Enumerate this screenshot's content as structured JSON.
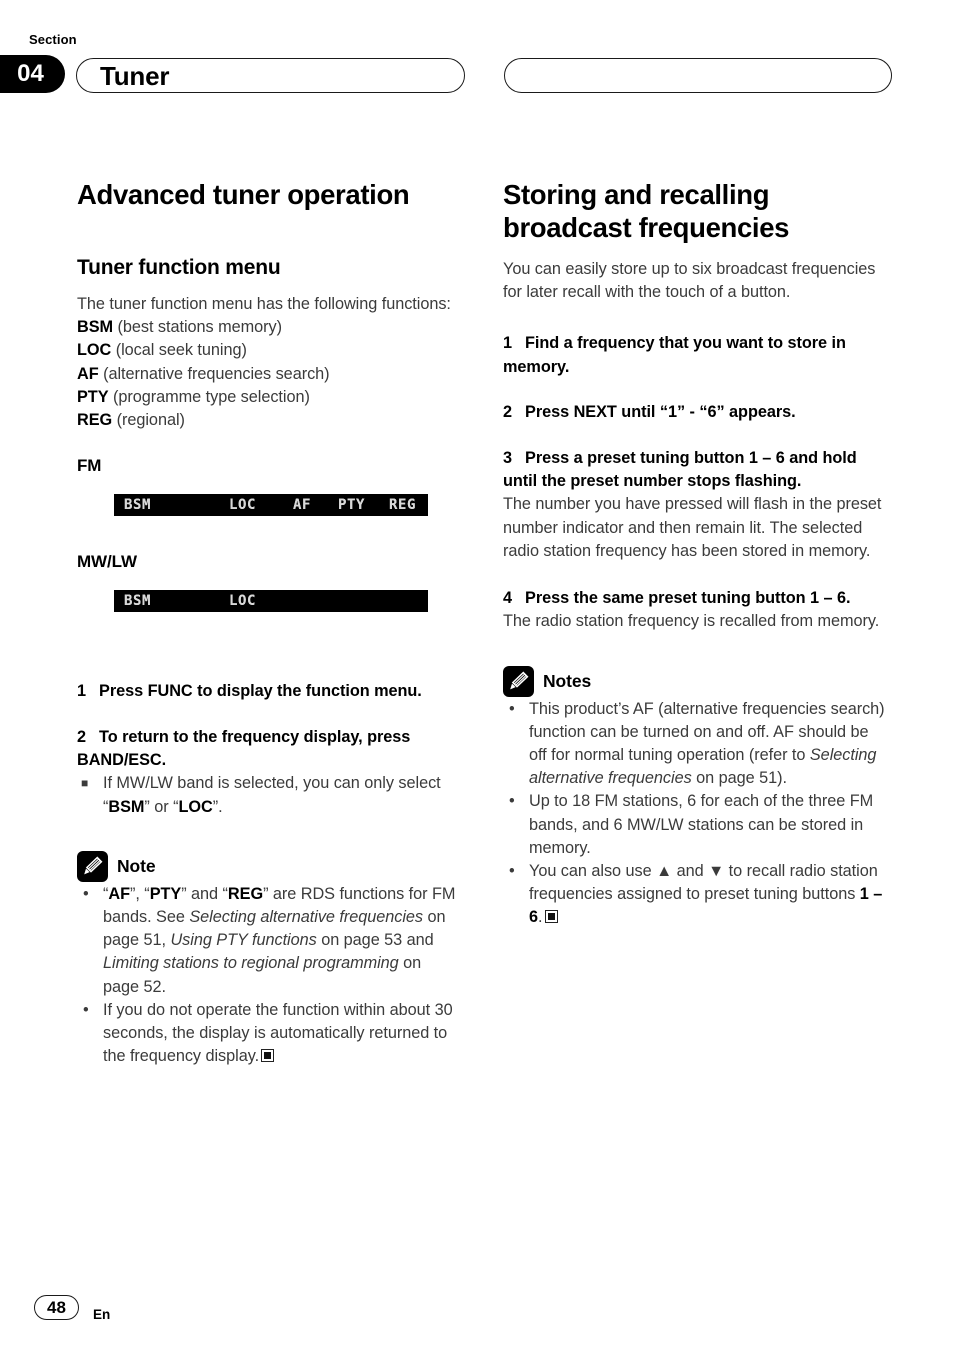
{
  "header": {
    "section_label": "Section",
    "section_number": "04",
    "chapter_title": "Tuner",
    "right_pill_title": ""
  },
  "left_column": {
    "main_heading": "Advanced tuner operation",
    "sub_heading": "Tuner function menu",
    "intro": "The tuner function menu has the following functions:",
    "function_list": [
      {
        "code": "BSM",
        "desc": "(best stations memory)"
      },
      {
        "code": "LOC",
        "desc": "(local seek tuning)"
      },
      {
        "code": "AF",
        "desc": "(alternative frequencies search)"
      },
      {
        "code": "PTY",
        "desc": "(programme type selection)"
      },
      {
        "code": "REG",
        "desc": "(regional)"
      }
    ],
    "fm_label": "FM",
    "fm_display": [
      "BSM",
      "LOC",
      "AF",
      "PTY",
      "REG"
    ],
    "mwlw_label": "MW/LW",
    "mwlw_display": [
      "BSM",
      "LOC"
    ],
    "steps": [
      {
        "num": "1",
        "text": "Press FUNC to display the function menu."
      },
      {
        "num": "2",
        "text": "To return to the frequency display, press BAND/ESC."
      }
    ],
    "step2_bullet_pre": "If MW/LW band is selected, you can only select “",
    "step2_bullet_b1": "BSM",
    "step2_bullet_mid": "” or “",
    "step2_bullet_b2": "LOC",
    "step2_bullet_post": "”.",
    "note": {
      "icon": "pencil-icon",
      "title": "Note",
      "bullets": [
        {
          "segments": [
            {
              "t": "“",
              "s": "n"
            },
            {
              "t": "AF",
              "s": "b"
            },
            {
              "t": "”, “",
              "s": "n"
            },
            {
              "t": "PTY",
              "s": "b"
            },
            {
              "t": "” and “",
              "s": "n"
            },
            {
              "t": "REG",
              "s": "b"
            },
            {
              "t": "” are RDS functions for FM bands. See ",
              "s": "n"
            },
            {
              "t": "Selecting alternative frequencies",
              "s": "i"
            },
            {
              "t": " on page 51, ",
              "s": "n"
            },
            {
              "t": "Using PTY functions",
              "s": "i"
            },
            {
              "t": " on page 53 and ",
              "s": "n"
            },
            {
              "t": "Limiting stations to regional programming",
              "s": "i"
            },
            {
              "t": " on page 52.",
              "s": "n"
            }
          ],
          "end": false
        },
        {
          "segments": [
            {
              "t": "If you do not operate the function within about 30 seconds, the display is automatically returned to the frequency display.",
              "s": "n"
            }
          ],
          "end": true
        }
      ]
    }
  },
  "right_column": {
    "main_heading": "Storing and recalling broadcast frequencies",
    "intro": "You can easily store up to six broadcast frequencies for later recall with the touch of a button.",
    "steps": [
      {
        "num": "1",
        "text": "Find a frequency that you want to store in memory.",
        "body": ""
      },
      {
        "num": "2",
        "text": "Press NEXT until “1” - “6” appears.",
        "body": ""
      },
      {
        "num": "3",
        "text": "Press a preset tuning button 1 – 6 and hold until the preset number stops flashing.",
        "body": "The number you have pressed will flash in the preset number indicator and then remain lit. The selected radio station frequency has been stored in memory."
      },
      {
        "num": "4",
        "text": "Press the same preset tuning button 1 – 6.",
        "body": "The radio station frequency is recalled from memory."
      }
    ],
    "notes": {
      "icon": "pencil-icon",
      "title": "Notes",
      "bullets": [
        {
          "segments": [
            {
              "t": "This product’s AF (alternative frequencies search) function can be turned on and off. AF should be off for normal tuning operation (refer to ",
              "s": "n"
            },
            {
              "t": "Selecting alternative frequencies",
              "s": "i"
            },
            {
              "t": " on page 51).",
              "s": "n"
            }
          ],
          "end": false
        },
        {
          "segments": [
            {
              "t": "Up to 18 FM stations, 6 for each of the three FM bands, and 6 MW/LW stations can be stored in memory.",
              "s": "n"
            }
          ],
          "end": false
        },
        {
          "segments": [
            {
              "t": "You can also use ▲ and ▼ to recall radio station frequencies assigned to preset tuning buttons ",
              "s": "n"
            },
            {
              "t": "1 – 6",
              "s": "b"
            },
            {
              "t": ".",
              "s": "n"
            }
          ],
          "end": true
        }
      ]
    }
  },
  "footer": {
    "page_number": "48",
    "language": "En"
  },
  "colors": {
    "ink": "#000000",
    "body_text": "#3b3b3b",
    "lcd_background": "#000000",
    "lcd_text": "#d8d8d8",
    "page_background": "#ffffff"
  }
}
